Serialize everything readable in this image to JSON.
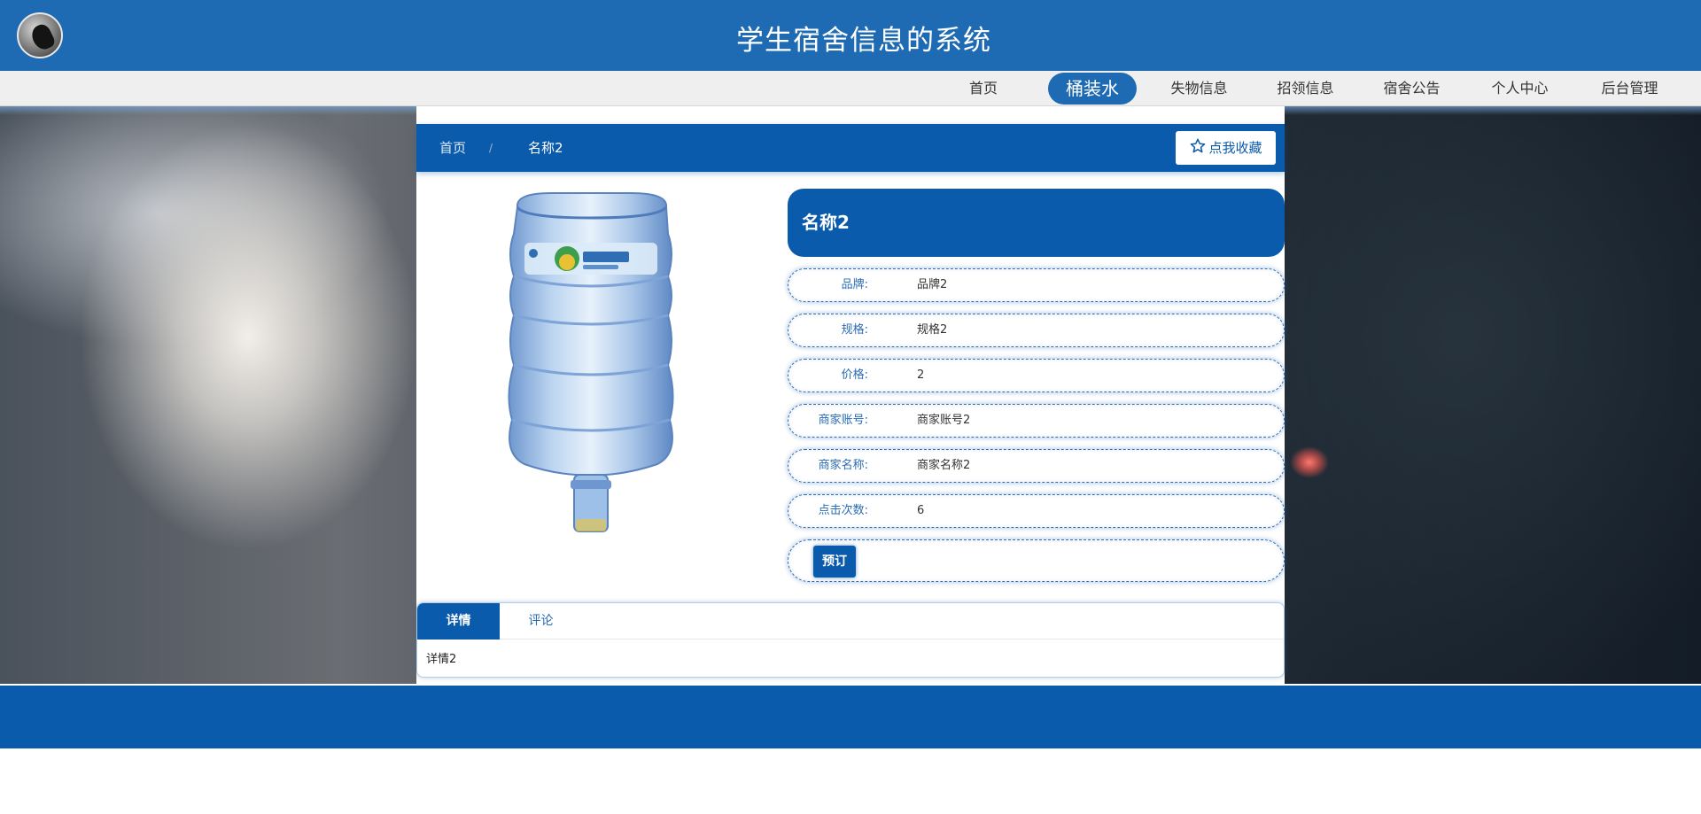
{
  "header": {
    "title": "学生宿舍信息的系统"
  },
  "nav": {
    "items": [
      {
        "label": "首页"
      },
      {
        "label": "桶装水",
        "active": true
      },
      {
        "label": "失物信息"
      },
      {
        "label": "招领信息"
      },
      {
        "label": "宿舍公告"
      },
      {
        "label": "个人中心"
      },
      {
        "label": "后台管理"
      }
    ]
  },
  "breadcrumb": {
    "home": "首页",
    "separator": "/",
    "current": "名称2"
  },
  "favorite": {
    "label": "点我收藏",
    "icon": "star-outline-icon"
  },
  "product": {
    "image": "water-bottle-image",
    "name": "名称2",
    "fields": [
      {
        "label": "品牌:",
        "value": "品牌2"
      },
      {
        "label": "规格:",
        "value": "规格2"
      },
      {
        "label": "价格:",
        "value": "2"
      },
      {
        "label": "商家账号:",
        "value": "商家账号2"
      },
      {
        "label": "商家名称:",
        "value": "商家名称2"
      },
      {
        "label": "点击次数:",
        "value": "6"
      }
    ],
    "order_label": "预订"
  },
  "tabs": {
    "details_label": "详情",
    "comments_label": "评论",
    "active": "详情",
    "content": "详情2"
  },
  "colors": {
    "primary": "#0b5bad",
    "header": "#1e6bb4",
    "nav_bg": "#efefef"
  }
}
